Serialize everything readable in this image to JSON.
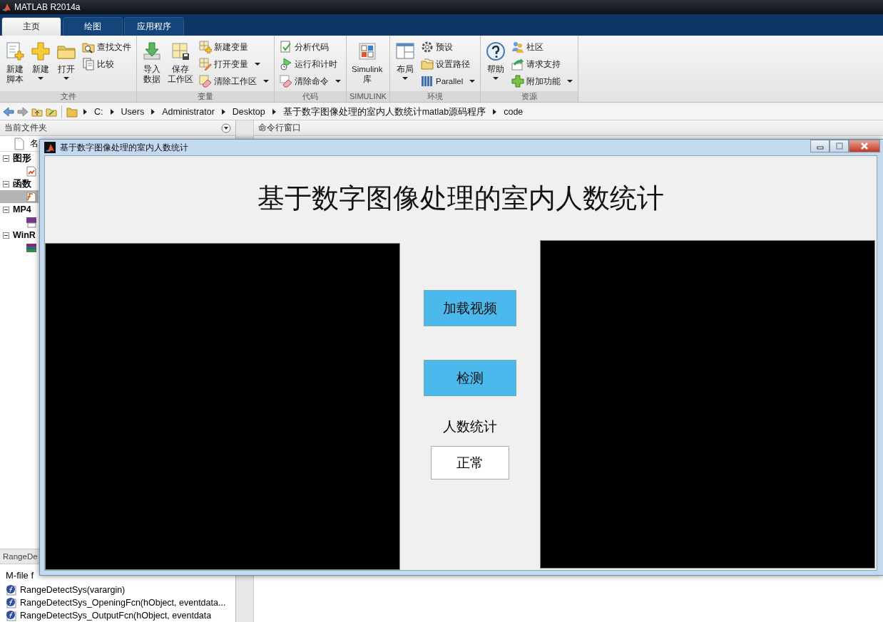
{
  "app_title": "MATLAB R2014a",
  "tabs": [
    {
      "label": "主页",
      "selected": true
    },
    {
      "label": "绘图",
      "selected": false
    },
    {
      "label": "应用程序",
      "selected": false
    }
  ],
  "ribbon_groups": [
    {
      "label": "文件",
      "items": [
        {
          "kind": "large",
          "lines": [
            "新建",
            "脚本"
          ],
          "dropdown": false
        },
        {
          "kind": "large",
          "lines": [
            "新建"
          ],
          "dropdown": true
        },
        {
          "kind": "large",
          "lines": [
            "打开"
          ],
          "dropdown": true
        },
        {
          "kind": "small",
          "lines": [
            "查找文件"
          ],
          "dropdown": false
        },
        {
          "kind": "small",
          "lines": [
            "比较"
          ],
          "dropdown": false
        }
      ]
    },
    {
      "label": "变量",
      "items": [
        {
          "kind": "large",
          "lines": [
            "导入",
            "数据"
          ],
          "dropdown": false
        },
        {
          "kind": "large",
          "lines": [
            "保存",
            "工作区"
          ],
          "dropdown": false
        },
        {
          "kind": "small",
          "lines": [
            "新建变量"
          ],
          "dropdown": false
        },
        {
          "kind": "small",
          "lines": [
            "打开变量"
          ],
          "dropdown": true
        },
        {
          "kind": "small",
          "lines": [
            "清除工作区"
          ],
          "dropdown": true
        }
      ]
    },
    {
      "label": "代码",
      "items": [
        {
          "kind": "small",
          "lines": [
            "分析代码"
          ],
          "dropdown": false
        },
        {
          "kind": "small",
          "lines": [
            "运行和计时"
          ],
          "dropdown": false
        },
        {
          "kind": "small",
          "lines": [
            "清除命令"
          ],
          "dropdown": true
        }
      ]
    },
    {
      "label": "SIMULINK",
      "items": [
        {
          "kind": "large",
          "lines": [
            "Simulink",
            "库"
          ],
          "dropdown": false
        }
      ]
    },
    {
      "label": "环境",
      "items": [
        {
          "kind": "large",
          "lines": [
            "布局"
          ],
          "dropdown": true
        },
        {
          "kind": "small",
          "lines": [
            "预设"
          ],
          "dropdown": false
        },
        {
          "kind": "small",
          "lines": [
            "设置路径"
          ],
          "dropdown": false
        },
        {
          "kind": "small",
          "lines": [
            "Parallel"
          ],
          "dropdown": true
        }
      ]
    },
    {
      "label": "资源",
      "items": [
        {
          "kind": "large",
          "lines": [
            "帮助"
          ],
          "dropdown": true
        },
        {
          "kind": "small",
          "lines": [
            "社区"
          ],
          "dropdown": false
        },
        {
          "kind": "small",
          "lines": [
            "请求支持"
          ],
          "dropdown": false
        },
        {
          "kind": "small",
          "lines": [
            "附加功能"
          ],
          "dropdown": true
        }
      ]
    }
  ],
  "address_path": [
    "C:",
    "Users",
    "Administrator",
    "Desktop",
    "基于数字图像处理的室内人数统计matlab源码程序",
    "code"
  ],
  "current_folder": {
    "title": "当前文件夹",
    "column_1": "名",
    "groups": [
      {
        "label": "图形",
        "expanded": true,
        "children": [
          {
            "selected": false
          }
        ]
      },
      {
        "label": "函数",
        "expanded": true,
        "children": [
          {
            "selected": true
          }
        ]
      },
      {
        "label": "MP4",
        "expanded": true,
        "children": [
          {
            "selected": false
          }
        ]
      },
      {
        "label": "WinR",
        "expanded": true,
        "children": [
          {
            "selected": false
          }
        ]
      }
    ],
    "details_title": "RangeDe",
    "details_description": "M-file f",
    "functions": [
      "RangeDetectSys(varargin)",
      "RangeDetectSys_OpeningFcn(hObject, eventdata...",
      "RangeDetectSys_OutputFcn(hObject, eventdata"
    ]
  },
  "command_window": {
    "title": "命令行窗口"
  },
  "figure": {
    "title": "基于数字图像处理的室内人数统计",
    "heading": "基于数字图像处理的室内人数统计",
    "buttons": [
      "加载视频",
      "检测"
    ],
    "count_label": "人数统计",
    "result": "正常"
  }
}
